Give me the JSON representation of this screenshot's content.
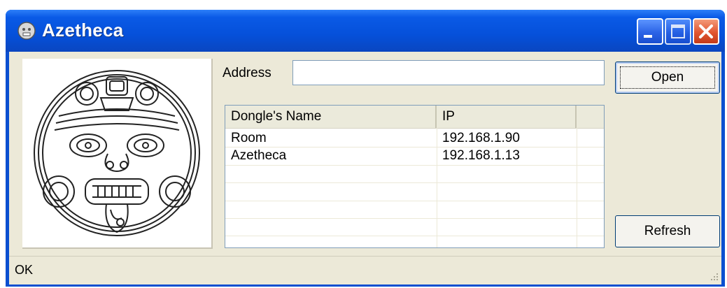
{
  "window": {
    "title": "Azetheca",
    "title_icon": "aztec-face-icon",
    "controls": [
      "minimize-icon",
      "maximize-icon",
      "close-icon"
    ]
  },
  "address": {
    "label": "Address",
    "value": "",
    "placeholder": ""
  },
  "buttons": {
    "open": "Open",
    "refresh": "Refresh"
  },
  "dongle_table": {
    "columns": [
      "Dongle's Name",
      "IP",
      ""
    ],
    "rows": [
      {
        "name": "Room",
        "ip": "192.168.1.90"
      },
      {
        "name": "Azetheca",
        "ip": "192.168.1.13"
      }
    ]
  },
  "status": {
    "text": "OK"
  },
  "colors": {
    "titlebar": "#0550da",
    "client": "#ece9d8",
    "close_button": "#e25530"
  }
}
